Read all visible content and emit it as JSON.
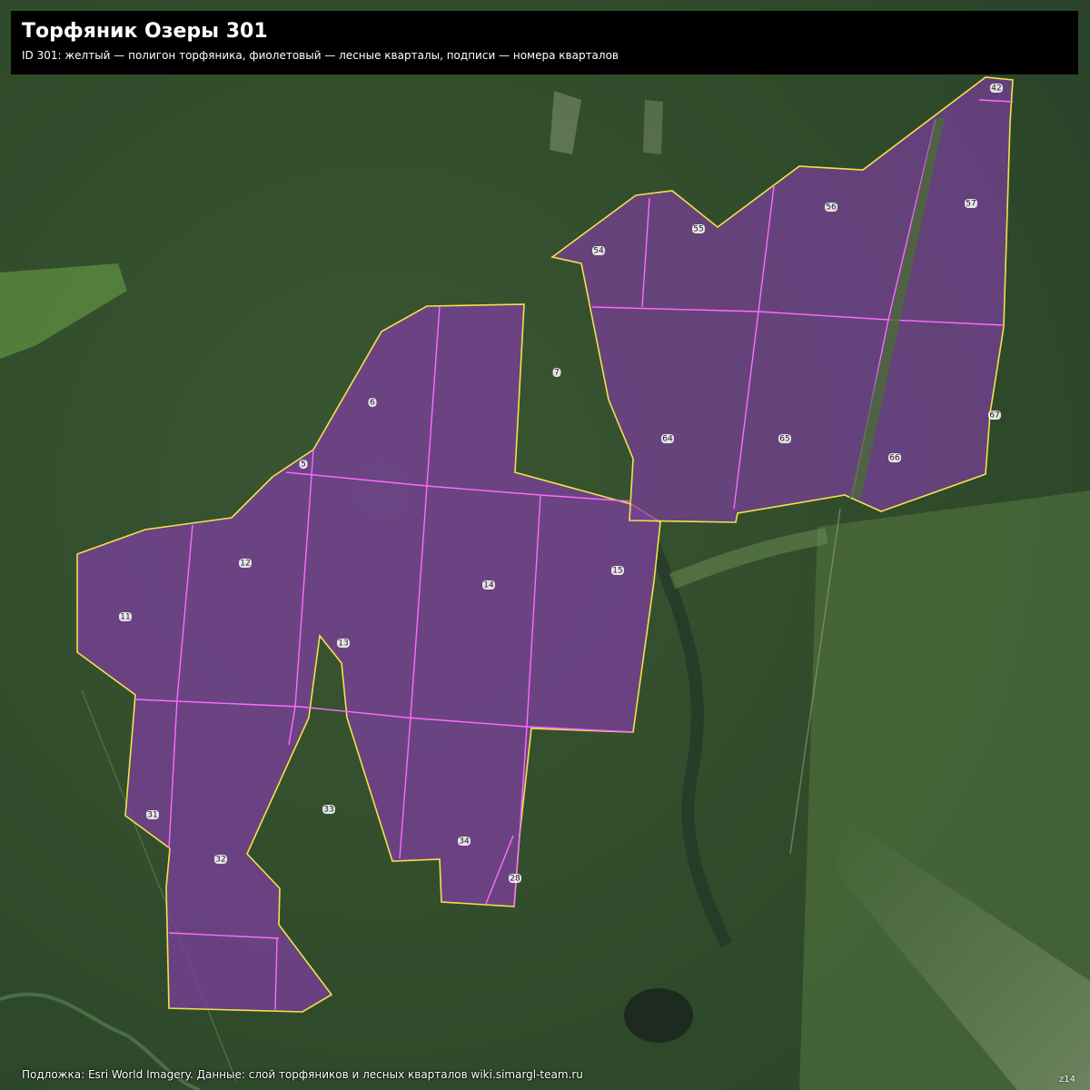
{
  "header": {
    "title": "Торфяник Озеры 301",
    "subtitle": "ID 301: желтый — полигон торфяника, фиолетовый — лесные кварталы, подписи — номера кварталов"
  },
  "legend_colors": {
    "peat_polygon": "#f2e24a",
    "forest_quarter_fill": "#7a3f9a",
    "forest_quarter_outline": "#ff6bff",
    "forest_dark": "#2b4226",
    "forest_mid": "#3c5a33",
    "clearing": "#4f7a3a",
    "bog_water": "#1d2a20"
  },
  "quarters": [
    {
      "id": "q42",
      "number": "42"
    },
    {
      "id": "q54",
      "number": "54"
    },
    {
      "id": "q55",
      "number": "55"
    },
    {
      "id": "q56",
      "number": "56"
    },
    {
      "id": "q57",
      "number": "57"
    },
    {
      "id": "q7",
      "number": "7"
    },
    {
      "id": "q6",
      "number": "6"
    },
    {
      "id": "q5",
      "number": "5"
    },
    {
      "id": "q64",
      "number": "64"
    },
    {
      "id": "q65",
      "number": "65"
    },
    {
      "id": "q66",
      "number": "66"
    },
    {
      "id": "q67",
      "number": "67"
    },
    {
      "id": "q12",
      "number": "12"
    },
    {
      "id": "q11",
      "number": "11"
    },
    {
      "id": "q14",
      "number": "14"
    },
    {
      "id": "q15",
      "number": "15"
    },
    {
      "id": "q13",
      "number": "13"
    },
    {
      "id": "q33",
      "number": "33"
    },
    {
      "id": "q31",
      "number": "31"
    },
    {
      "id": "q32",
      "number": "32"
    },
    {
      "id": "q34",
      "number": "34"
    },
    {
      "id": "q28",
      "number": "28"
    }
  ],
  "footer": {
    "attribution": "Подложка: Esri World Imagery. Данные: слой торфяников и лесных кварталов wiki.simargl-team.ru",
    "zoom": "z14"
  }
}
